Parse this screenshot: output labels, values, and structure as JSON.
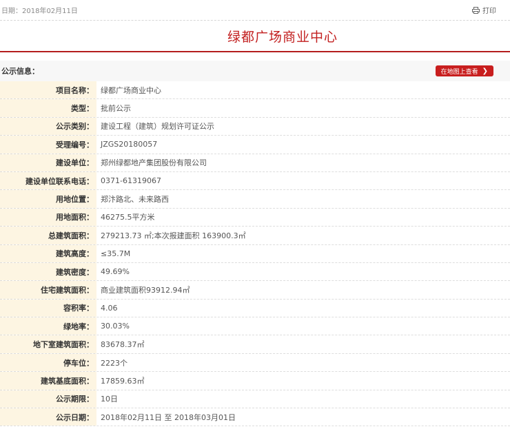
{
  "header": {
    "date_text": "日期：2018年02月11日",
    "print_label": "打印"
  },
  "title": "绿都广场商业中心",
  "section": {
    "title": "公示信息：",
    "map_button_label": "在地图上查看"
  },
  "rows": [
    {
      "label": "项目名称：",
      "value": "绿都广场商业中心"
    },
    {
      "label": "类型：",
      "value": "批前公示"
    },
    {
      "label": "公示类别：",
      "value": "建设工程（建筑）规划许可证公示"
    },
    {
      "label": "受理编号：",
      "value": "JZGS20180057"
    },
    {
      "label": "建设单位：",
      "value": "郑州绿都地产集团股份有限公司"
    },
    {
      "label": "建设单位联系电话：",
      "value": "0371-61319067"
    },
    {
      "label": "用地位置：",
      "value": "郑汴路北、未来路西"
    },
    {
      "label": "用地面积：",
      "value": "46275.5平方米"
    },
    {
      "label": "总建筑面积：",
      "value": "279213.73 ㎡;本次报建面积 163900.3㎡"
    },
    {
      "label": "建筑高度：",
      "value": "≤35.7M"
    },
    {
      "label": "建筑密度：",
      "value": "49.69%"
    },
    {
      "label": "住宅建筑面积：",
      "value": "商业建筑面积93912.94㎡"
    },
    {
      "label": "容积率：",
      "value": "4.06"
    },
    {
      "label": "绿地率：",
      "value": "30.03%"
    },
    {
      "label": "地下室建筑面积：",
      "value": "83678.37㎡"
    },
    {
      "label": "停车位：",
      "value": "2223个"
    },
    {
      "label": "建筑基底面积：",
      "value": "17859.63㎡"
    },
    {
      "label": "公示期限：",
      "value": "10日"
    },
    {
      "label": "公示日期：",
      "value": "2018年02月11日 至 2018年03月01日"
    }
  ],
  "colors": {
    "accent": "#c21f1f",
    "label_bg": "#fdf5e2"
  }
}
